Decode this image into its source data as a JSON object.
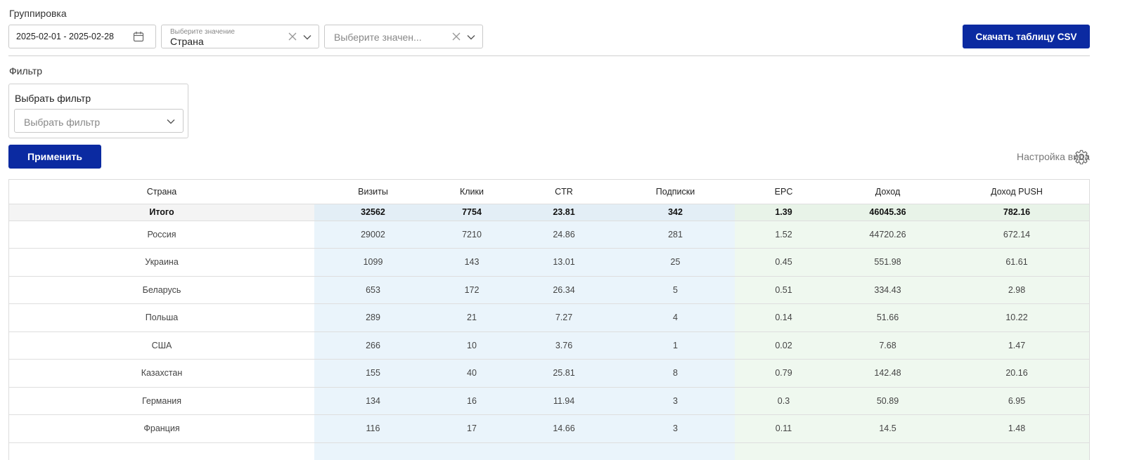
{
  "grouping": {
    "label": "Группировка",
    "date_range": "2025-02-01 - 2025-02-28",
    "select1_placeholder": "Выберите значение",
    "select1_value": "Страна",
    "select2_placeholder": "Выберите значен..."
  },
  "toolbar": {
    "csv_button": "Скачать таблицу CSV"
  },
  "filter": {
    "label": "Фильтр",
    "box_title": "Выбрать фильтр",
    "select_placeholder": "Выбрать фильтр",
    "apply_button": "Применить"
  },
  "view_settings_label": "Настройка вида",
  "colors": {
    "primary": "#0b2aa1",
    "blue_col_bg": "#eaf4fb",
    "green_col_bg": "#eff8ef"
  },
  "table": {
    "headers": [
      "Страна",
      "Визиты",
      "Клики",
      "CTR",
      "Подписки",
      "EPC",
      "Доход",
      "Доход PUSH"
    ],
    "total": [
      "Итого",
      "32562",
      "7754",
      "23.81",
      "342",
      "1.39",
      "46045.36",
      "782.16"
    ],
    "rows": [
      [
        "Россия",
        "29002",
        "7210",
        "24.86",
        "281",
        "1.52",
        "44720.26",
        "672.14"
      ],
      [
        "Украина",
        "1099",
        "143",
        "13.01",
        "25",
        "0.45",
        "551.98",
        "61.61"
      ],
      [
        "Беларусь",
        "653",
        "172",
        "26.34",
        "5",
        "0.51",
        "334.43",
        "2.98"
      ],
      [
        "Польша",
        "289",
        "21",
        "7.27",
        "4",
        "0.14",
        "51.66",
        "10.22"
      ],
      [
        "США",
        "266",
        "10",
        "3.76",
        "1",
        "0.02",
        "7.68",
        "1.47"
      ],
      [
        "Казахстан",
        "155",
        "40",
        "25.81",
        "8",
        "0.79",
        "142.48",
        "20.16"
      ],
      [
        "Германия",
        "134",
        "16",
        "11.94",
        "3",
        "0.3",
        "50.89",
        "6.95"
      ],
      [
        "Франция",
        "116",
        "17",
        "14.66",
        "3",
        "0.11",
        "14.5",
        "1.48"
      ]
    ]
  }
}
